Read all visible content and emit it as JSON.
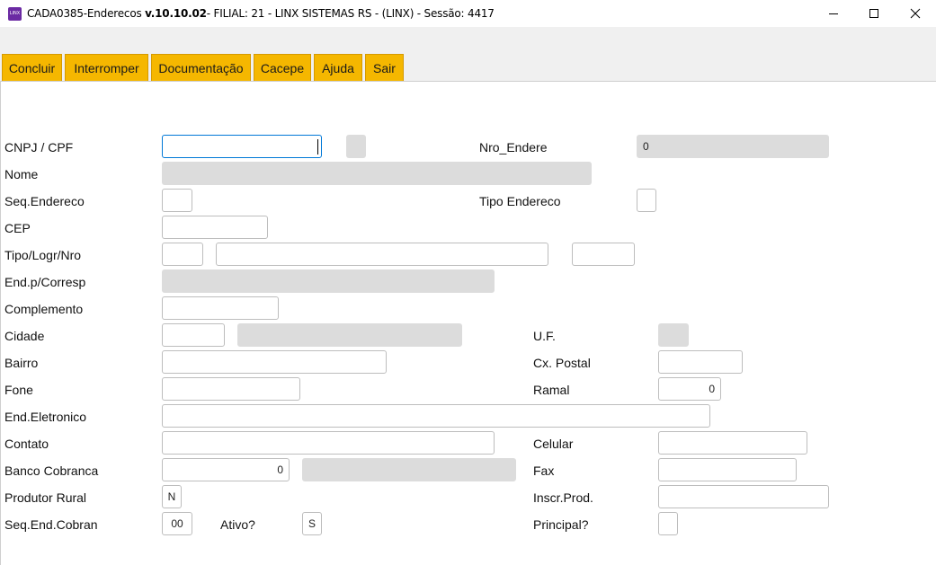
{
  "window": {
    "icon_text": "LINX",
    "program": "CADA0385-Enderecos",
    "version": "v.10.10.02",
    "filial_info": "- FILIAL: 21 - LINX SISTEMAS RS - (LINX) - Sessão: 4417"
  },
  "toolbar": {
    "concluir": "Concluir",
    "interromper": "Interromper",
    "documentacao": "Documentação",
    "cacepe": "Cacepe",
    "ajuda": "Ajuda",
    "sair": "Sair"
  },
  "labels": {
    "cnpj_cpf": "CNPJ / CPF",
    "nro_endere": "Nro_Endere",
    "nome": "Nome",
    "seq_endereco": "Seq.Endereco",
    "tipo_endereco": "Tipo Endereco",
    "cep": "CEP",
    "tipo_logr_nro": "Tipo/Logr/Nro",
    "end_p_corresp": "End.p/Corresp",
    "complemento": "Complemento",
    "cidade": "Cidade",
    "uf": "U.F.",
    "bairro": "Bairro",
    "cx_postal": "Cx. Postal",
    "fone": "Fone",
    "ramal": "Ramal",
    "end_eletronico": "End.Eletronico",
    "contato": "Contato",
    "celular": "Celular",
    "banco_cobranca": "Banco Cobranca",
    "fax": "Fax",
    "produtor_rural": "Produtor Rural",
    "inscr_prod": "Inscr.Prod.",
    "seq_end_cobran": "Seq.End.Cobran",
    "ativo": "Ativo?",
    "principal": "Principal?"
  },
  "values": {
    "nro_endere": "0",
    "ramal": "0",
    "banco_cobranca": "0",
    "produtor_rural": "N",
    "seq_end_cobran": "00",
    "ativo": "S"
  }
}
